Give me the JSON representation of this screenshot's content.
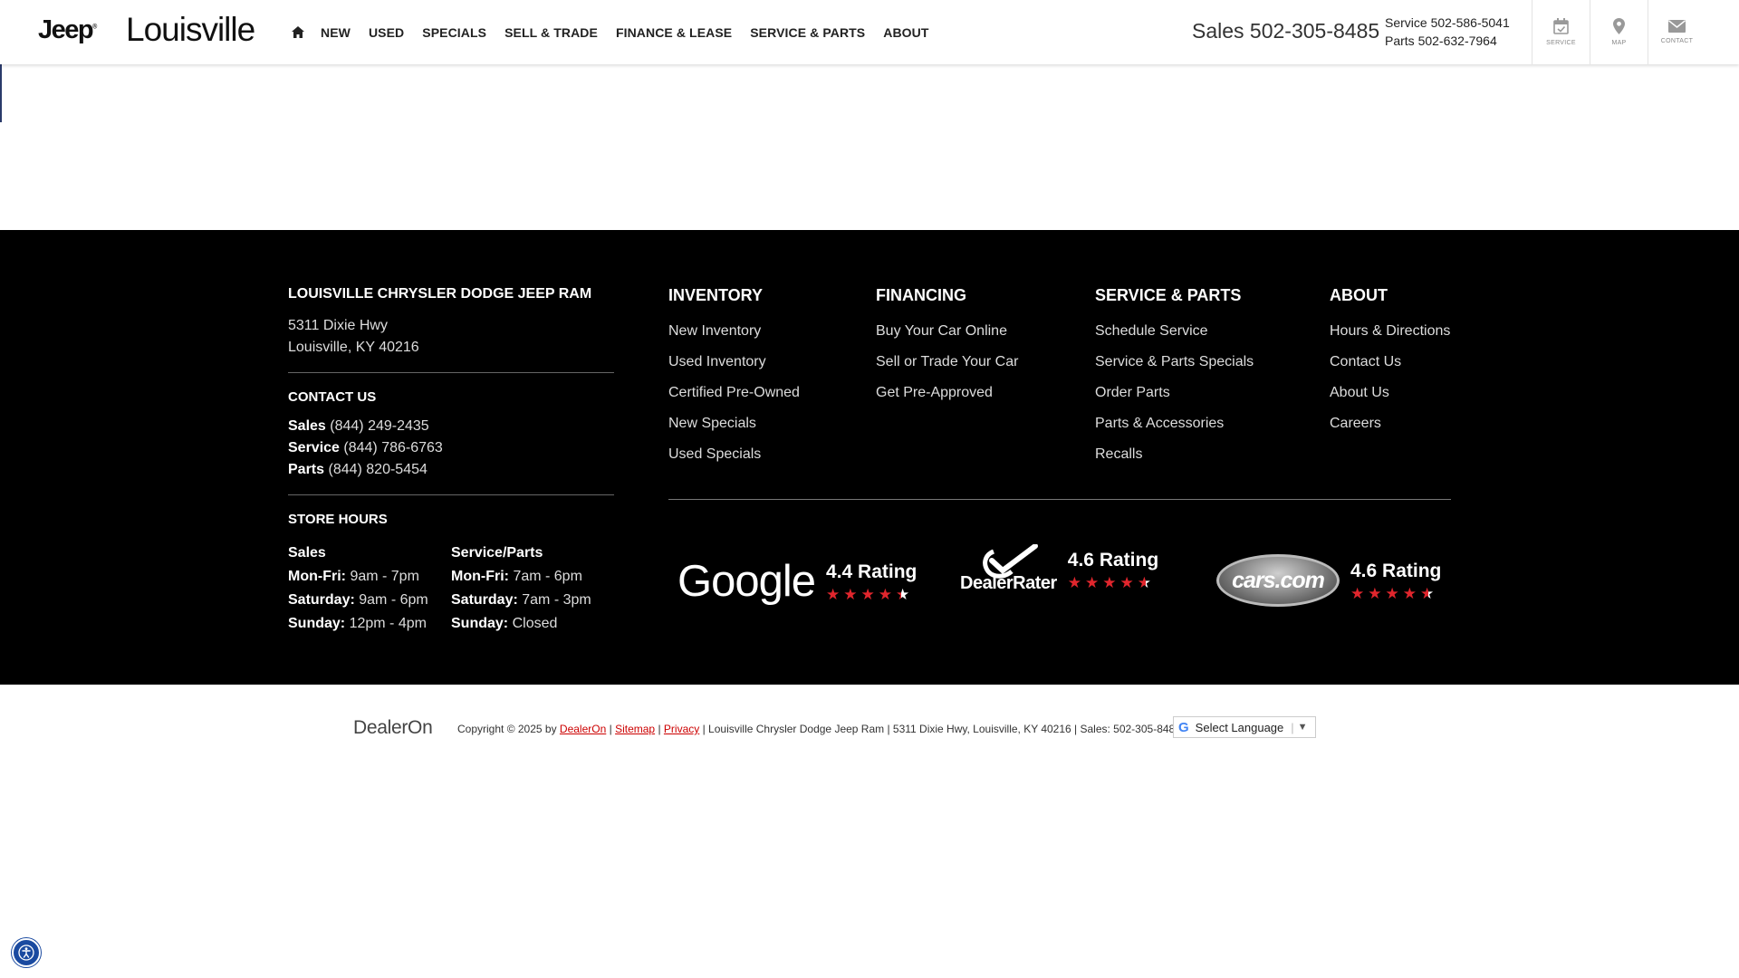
{
  "header": {
    "brand": "Jeep",
    "city": "Louisville",
    "nav": [
      "NEW",
      "USED",
      "SPECIALS",
      "SELL & TRADE",
      "FINANCE & LEASE",
      "SERVICE & PARTS",
      "ABOUT"
    ],
    "sales_phone": "Sales 502-305-8485",
    "service_phone": "Service 502-586-5041",
    "parts_phone": "Parts 502-632-7964",
    "icon_labels": [
      "SERVICE",
      "MAP",
      "CONTACT"
    ]
  },
  "footer": {
    "dealer_name": "LOUISVILLE CHRYSLER DODGE JEEP RAM",
    "address_line1": "5311 Dixie Hwy",
    "address_line2": "Louisville, KY 40216",
    "contact_title": "CONTACT US",
    "contacts": [
      {
        "label": "Sales",
        "value": "(844) 249-2435"
      },
      {
        "label": "Service",
        "value": "(844) 786-6763"
      },
      {
        "label": "Parts",
        "value": "(844) 820-5454"
      }
    ],
    "hours_title": "STORE HOURS",
    "hours": [
      {
        "dept": "Sales",
        "rows": [
          {
            "day": "Mon-Fri:",
            "time": "9am - 7pm"
          },
          {
            "day": "Saturday:",
            "time": "9am - 6pm"
          },
          {
            "day": "Sunday:",
            "time": "12pm - 4pm"
          }
        ]
      },
      {
        "dept": "Service/Parts",
        "rows": [
          {
            "day": "Mon-Fri:",
            "time": "7am - 6pm"
          },
          {
            "day": "Saturday:",
            "time": "7am - 3pm"
          },
          {
            "day": "Sunday:",
            "time": "Closed"
          }
        ]
      }
    ],
    "link_columns": [
      {
        "title": "INVENTORY",
        "links": [
          "New Inventory",
          "Used Inventory",
          "Certified Pre-Owned",
          "New Specials",
          "Used Specials"
        ]
      },
      {
        "title": "FINANCING",
        "links": [
          "Buy Your Car Online",
          "Sell or Trade Your Car",
          "Get Pre-Approved"
        ]
      },
      {
        "title": "SERVICE & PARTS",
        "links": [
          "Schedule Service",
          "Service & Parts Specials",
          "Order Parts",
          "Parts & Accessories",
          "Recalls"
        ]
      },
      {
        "title": "ABOUT",
        "links": [
          "Hours & Directions",
          "Contact Us",
          "About Us",
          "Careers"
        ]
      }
    ],
    "ratings": [
      {
        "source": "Google",
        "text": "4.4 Rating",
        "value": 4.4
      },
      {
        "source": "DealerRater",
        "text": "4.6 Rating",
        "value": 4.6
      },
      {
        "source": "cars.com",
        "text": "4.6 Rating",
        "value": 4.6
      }
    ]
  },
  "bottom": {
    "provider": "DealerOn",
    "copyright_prefix": "Copyright © 2025 by",
    "dealeron_link": "DealerOn",
    "sitemap_link": "Sitemap",
    "privacy_link": "Privacy",
    "copyright_suffix": "| Louisville Chrysler Dodge Jeep Ram |  5311 Dixie Hwy, Louisville, KY 40216 | Sales: 502-305-8485",
    "language_select": "Select Language"
  },
  "colors": {
    "star": "#e1262d",
    "footer_bg": "#000000",
    "link_red": "#cc0000",
    "a11y_blue": "#1a4aa0"
  }
}
